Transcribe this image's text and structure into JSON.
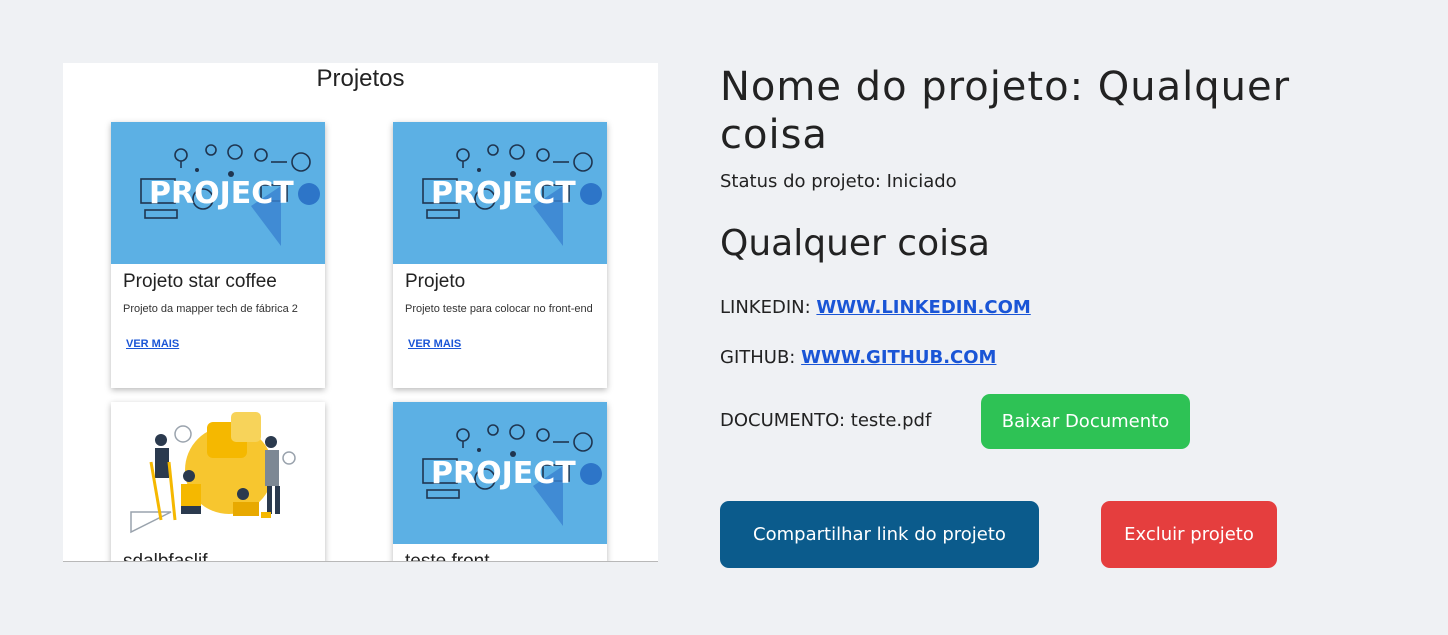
{
  "projects_panel": {
    "title": "Projetos",
    "cards": [
      {
        "title": "Projeto star coffee",
        "description": "Projeto da mapper tech de fábrica 2",
        "link": "VER MAIS",
        "image": "project-banner-illustration"
      },
      {
        "title": "Projeto",
        "description": "Projeto teste para colocar no front-end",
        "link": "VER MAIS",
        "image": "project-banner-illustration"
      },
      {
        "title": "sdalbfaslif",
        "description": "",
        "link": "",
        "image": "team-puzzle-illustration"
      },
      {
        "title": "teste front",
        "description": "",
        "link": "",
        "image": "project-banner-illustration"
      }
    ],
    "banner_word": "PROJECT"
  },
  "details": {
    "name_line": "Nome do projeto: Qualquer coisa",
    "status_line": "Status do projeto: Iniciado",
    "subtitle": "Qualquer coisa",
    "linkedin_label": "LINKEDIN: ",
    "linkedin_link": "WWW.LINKEDIN.COM",
    "github_label": "GITHUB: ",
    "github_link": "WWW.GITHUB.COM",
    "document_label": "DOCUMENTO: teste.pdf"
  },
  "buttons": {
    "download": "Baixar Documento",
    "share": "Compartilhar link do projeto",
    "delete": "Excluir projeto"
  },
  "colors": {
    "background": "#eff1f4",
    "link": "#1a55d6",
    "download_button": "#2ec255",
    "share_button": "#0b5b8c",
    "delete_button": "#e53e3e",
    "banner_blue": "#5cb0e4"
  }
}
